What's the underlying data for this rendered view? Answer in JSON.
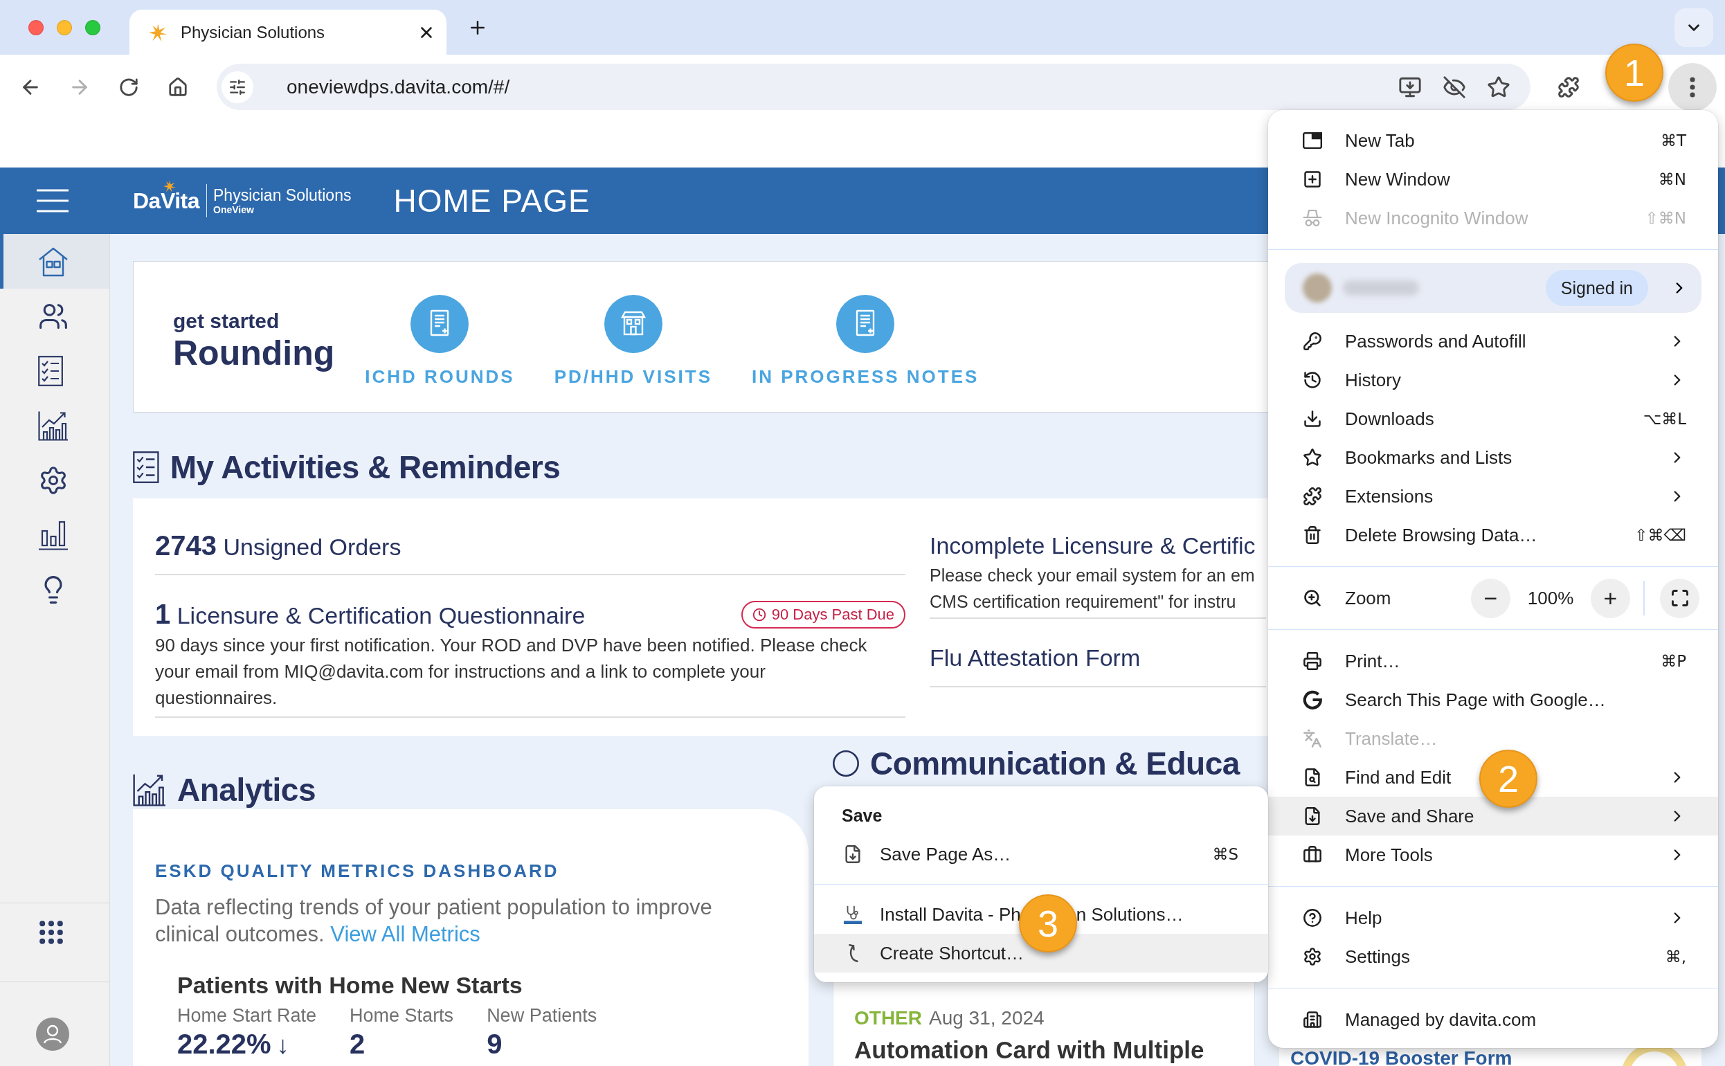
{
  "browser": {
    "tab": {
      "title": "Physician Solutions",
      "selected": true
    },
    "back_disabled": false,
    "forward_disabled": true,
    "url": "oneviewdps.davita.com/#/",
    "menu_button_pressed": true
  },
  "annotations": [
    {
      "label": "1"
    },
    {
      "label": "2"
    },
    {
      "label": "3"
    }
  ],
  "header": {
    "logo_name": "DaVita",
    "logo_product": "Physician Solutions",
    "logo_sub": "OneView",
    "title": "HOME PAGE"
  },
  "sidebar": {
    "items": [
      {
        "selected": true
      },
      {
        "selected": false
      },
      {
        "selected": false
      },
      {
        "selected": false
      },
      {
        "selected": false
      },
      {
        "selected": false
      },
      {
        "selected": false
      }
    ]
  },
  "rounding": {
    "kicker": "get started",
    "title": "Rounding",
    "actions": [
      {
        "label": "ICHD ROUNDS"
      },
      {
        "label": "PD/HHD VISITS"
      },
      {
        "label": "IN PROGRESS NOTES"
      }
    ]
  },
  "activities": {
    "title": "My Activities & Reminders",
    "items": [
      {
        "title": "**2743** Unsigned Orders"
      },
      {
        "title": "**1** Licensure & Certification Questionnaire",
        "badge": "90 Days Past Due",
        "description": "90 days since your first notification. Your ROD and DVP have been notified. Please check your email from MIQ@davita.com for instructions and a link to complete your questionnaires."
      }
    ],
    "side_items": [
      {
        "title": "Incomplete Licensure & Certific",
        "description": "Please check your email system for an em\nCMS certification requirement\" for instru"
      },
      {
        "title": "Flu Attestation Form"
      }
    ]
  },
  "analytics": {
    "title": "Analytics",
    "heading": "ESKD QUALITY METRICS DASHBOARD",
    "text": "Data reflecting trends of your patient population to improve clinical outcomes.",
    "link": "View All Metrics",
    "subheading": "Patients with Home New Starts",
    "metrics": [
      {
        "label": "Home Start Rate",
        "value": "22.22%",
        "trend": "↓"
      },
      {
        "label": "Home Starts",
        "value": "2"
      },
      {
        "label": "New Patients",
        "value": "9"
      }
    ]
  },
  "communication": {
    "title": "Communication & Educa",
    "cards": [
      {
        "tag": "OTHER",
        "color": "#86b53a",
        "date": "Aug 31, 2024",
        "title": "Automation Card with Multiple"
      }
    ]
  },
  "covid_card": {
    "title": "COVID-19 Booster Form"
  },
  "chrome_menu": {
    "items": [
      {
        "kind": "item",
        "label": "New Tab",
        "shortcut": "⌘T",
        "disabled": false,
        "selected": false,
        "submenu": false
      },
      {
        "kind": "item",
        "label": "New Window",
        "shortcut": "⌘N",
        "disabled": false,
        "selected": false,
        "submenu": false
      },
      {
        "kind": "item",
        "label": "New Incognito Window",
        "shortcut": "⇧⌘N",
        "disabled": true,
        "selected": false,
        "submenu": false
      },
      {
        "kind": "divider"
      },
      {
        "kind": "profile",
        "status": "Signed in"
      },
      {
        "kind": "item",
        "label": "Passwords and Autofill",
        "disabled": false,
        "selected": false,
        "submenu": true
      },
      {
        "kind": "item",
        "label": "History",
        "disabled": false,
        "selected": false,
        "submenu": true
      },
      {
        "kind": "item",
        "label": "Downloads",
        "shortcut": "⌥⌘L",
        "disabled": false,
        "selected": false,
        "submenu": false
      },
      {
        "kind": "item",
        "label": "Bookmarks and Lists",
        "disabled": false,
        "selected": false,
        "submenu": true
      },
      {
        "kind": "item",
        "label": "Extensions",
        "disabled": false,
        "selected": false,
        "submenu": true
      },
      {
        "kind": "item",
        "label": "Delete Browsing Data…",
        "shortcut": "⇧⌘⌫",
        "disabled": false,
        "selected": false,
        "submenu": false
      },
      {
        "kind": "divider"
      },
      {
        "kind": "zoom",
        "label": "Zoom",
        "decrease": "−",
        "value": "100%",
        "increase": "+"
      },
      {
        "kind": "divider"
      },
      {
        "kind": "item",
        "label": "Print…",
        "shortcut": "⌘P",
        "disabled": false,
        "selected": false,
        "submenu": false
      },
      {
        "kind": "item",
        "label": "Search This Page with Google…",
        "disabled": false,
        "selected": false,
        "submenu": false
      },
      {
        "kind": "item",
        "label": "Translate…",
        "disabled": true,
        "selected": false,
        "submenu": false
      },
      {
        "kind": "item",
        "label": "Find and Edit",
        "disabled": false,
        "selected": false,
        "submenu": true
      },
      {
        "kind": "item",
        "label": "Save and Share",
        "disabled": false,
        "selected": true,
        "submenu": true
      },
      {
        "kind": "item",
        "label": "More Tools",
        "disabled": false,
        "selected": false,
        "submenu": true
      },
      {
        "kind": "divider"
      },
      {
        "kind": "item",
        "label": "Help",
        "disabled": false,
        "selected": false,
        "submenu": true
      },
      {
        "kind": "item",
        "label": "Settings",
        "shortcut": "⌘,",
        "disabled": false,
        "selected": false,
        "submenu": false
      },
      {
        "kind": "divider"
      },
      {
        "kind": "item",
        "label": "Managed by davita.com",
        "disabled": false,
        "selected": false,
        "submenu": false
      }
    ]
  },
  "save_submenu": {
    "title": "Save",
    "items": [
      {
        "kind": "item",
        "label": "Save Page As…",
        "shortcut": "⌘S",
        "selected": false
      },
      {
        "kind": "divider"
      },
      {
        "kind": "item",
        "label_parts": [
          "Install Davita - Ph",
          "n Solutions…"
        ],
        "selected": false
      },
      {
        "kind": "item",
        "label": "Create Shortcut…",
        "selected": true
      }
    ]
  }
}
